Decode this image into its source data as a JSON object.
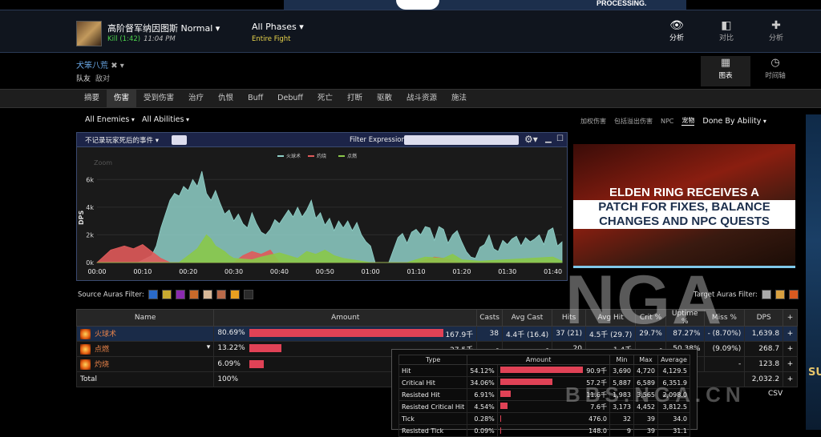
{
  "banner": {
    "text": "PROCESSING."
  },
  "header": {
    "boss": "高阶督军纳因图斯 Normal ▾",
    "kill": "Kill (1:42)",
    "time": "11:04 PM",
    "phases": "All Phases ▾",
    "fight": "Entire Fight",
    "nav": [
      {
        "label": "分析",
        "icon": "eye-icon",
        "glyph": "👁"
      },
      {
        "label": "对比",
        "icon": "compare-icon",
        "glyph": "◧"
      },
      {
        "label": "分析",
        "icon": "puzzle-icon",
        "glyph": "✚"
      }
    ]
  },
  "player": {
    "name": "犬笨八荒",
    "close": "✖ ▾",
    "team": "队友",
    "enemy": "敌对"
  },
  "views": [
    {
      "label": "图表",
      "icon": "grid-icon",
      "glyph": "▦"
    },
    {
      "label": "时间轴",
      "icon": "clock-icon",
      "glyph": "◷"
    }
  ],
  "tabs": [
    "摘要",
    "伤害",
    "受到伤害",
    "治疗",
    "仇恨",
    "Buff",
    "Debuff",
    "死亡",
    "打断",
    "驱散",
    "战斗资源",
    "施法"
  ],
  "filters": {
    "enemies": "All Enemies",
    "abilities": "All Abilities",
    "right": [
      "加权伤害",
      "包括溢出伤害",
      "NPC",
      "宠物"
    ],
    "done_by": "Done By Ability"
  },
  "graph": {
    "death_events": "不记录玩家死后的事件 ▾",
    "filter_expression": "Filter Expression:",
    "zoom": "Zoom"
  },
  "chart_data": {
    "type": "area",
    "ylabel": "DPS",
    "ylim": [
      0,
      7000
    ],
    "yticks": [
      "0k",
      "2k",
      "4k",
      "6k"
    ],
    "xticks": [
      "00:00",
      "00:10",
      "00:20",
      "00:30",
      "00:40",
      "00:50",
      "01:00",
      "01:10",
      "01:20",
      "01:30",
      "01:40"
    ],
    "xlim": [
      0,
      102
    ],
    "series": [
      {
        "name": "火球术",
        "color": "#8fd0c8",
        "x": [
          0,
          3,
          6,
          9,
          12,
          13,
          14,
          15,
          16,
          17,
          18,
          19,
          20,
          21,
          22,
          23,
          24,
          25,
          26,
          27,
          28,
          29,
          30,
          31,
          32,
          33,
          34,
          35,
          36,
          37,
          38,
          39,
          40,
          41,
          42,
          43,
          44,
          45,
          46,
          47,
          48,
          49,
          50,
          51,
          52,
          53,
          54,
          55,
          56,
          57,
          58,
          59,
          60,
          61,
          62,
          63,
          64,
          65,
          66,
          67,
          68,
          69,
          70,
          71,
          72,
          73,
          74,
          75,
          76,
          77,
          78,
          79,
          80,
          81,
          82,
          83,
          84,
          85,
          86,
          87,
          88,
          89,
          90,
          91,
          92,
          93,
          94,
          95,
          96,
          97,
          98,
          99,
          100,
          101,
          102
        ],
        "y": [
          0,
          0,
          0,
          0,
          500,
          1200,
          2500,
          3500,
          4500,
          5000,
          4800,
          5500,
          5200,
          6000,
          5500,
          6600,
          5000,
          4500,
          5200,
          4300,
          3500,
          3800,
          3000,
          3500,
          2800,
          2500,
          3600,
          2800,
          2200,
          2000,
          2400,
          3100,
          2800,
          3300,
          3800,
          3300,
          4000,
          3300,
          3800,
          4500,
          3200,
          3600,
          2700,
          3200,
          2300,
          3000,
          2500,
          3000,
          2300,
          2900,
          2000,
          1500,
          1200,
          0,
          0,
          0,
          0,
          900,
          1800,
          2100,
          1400,
          2200,
          2400,
          2000,
          2600,
          2500,
          1600,
          2600,
          2400,
          1400,
          2000,
          2300,
          1500,
          800,
          400,
          300,
          1100,
          1300,
          2000,
          1000,
          800,
          1600,
          1300,
          1700,
          1900,
          1200,
          1800,
          1500,
          1700,
          2000,
          1300,
          2300,
          2500,
          1200,
          1500
        ]
      },
      {
        "name": "灼烧",
        "color": "#e05a5a",
        "x": [
          0,
          3,
          6,
          8,
          10,
          12,
          14,
          16,
          30,
          32,
          34,
          36,
          38,
          40,
          70,
          74,
          76,
          80,
          84,
          100
        ],
        "y": [
          0,
          900,
          1200,
          1000,
          1300,
          800,
          300,
          0,
          0,
          500,
          800,
          600,
          900,
          0,
          0,
          400,
          300,
          0,
          0,
          0
        ]
      },
      {
        "name": "点燃",
        "color": "#8ac84a",
        "x": [
          0,
          18,
          20,
          22,
          23,
          24,
          25,
          26,
          27,
          28,
          29,
          30,
          34,
          36,
          40,
          44,
          46,
          48,
          50,
          52,
          54,
          56,
          60,
          68,
          70,
          72,
          76,
          78,
          80,
          84,
          100,
          102
        ],
        "y": [
          0,
          0,
          500,
          1000,
          1500,
          2000,
          1700,
          1200,
          1000,
          800,
          500,
          300,
          200,
          400,
          700,
          300,
          800,
          600,
          900,
          500,
          300,
          200,
          0,
          0,
          200,
          400,
          300,
          600,
          200,
          100,
          400,
          100
        ]
      }
    ]
  },
  "ad": {
    "line1": "ELDEN RING RECEIVES A",
    "line2": "PATCH FOR FIXES, BALANCE",
    "line3": "CHANGES AND NPC QUESTS"
  },
  "auras": {
    "source": "Source Auras Filter:",
    "target": "Target Auras Filter:",
    "source_colors": [
      "#2a6ac8",
      "#c8aa30",
      "#8a2ab0",
      "#c86a2a",
      "#d8b898",
      "#b86a4a",
      "#e8a020",
      "#2a2a2a"
    ],
    "target_colors": [
      "#aaaaaa",
      "#d8a040",
      "#d85a20"
    ]
  },
  "table": {
    "headers": [
      "Name",
      "Amount",
      "Casts",
      "Avg Cast",
      "Hits",
      "Avg Hit",
      "Crit %",
      "Uptime %",
      "Miss %",
      "DPS",
      "+"
    ],
    "rows": [
      {
        "name": "火球术",
        "pct": "80.69%",
        "bar": 0.8069,
        "amount": "167.9千",
        "casts": "38",
        "avgcast": "4.4千 (16.4)",
        "hits": "37 (21)",
        "avghit": "4.5千 (29.7)",
        "crit": "29.7%",
        "uptime": "87.27%",
        "miss": "- (8.70%)",
        "dps": "1,639.8",
        "plus": "+"
      },
      {
        "name": "点燃",
        "pct": "13.22%",
        "bar": 0.1322,
        "amount": "27.5千",
        "casts": "-",
        "avgcast": "-",
        "hits": "20",
        "avghit": "1.4千",
        "crit": "-",
        "uptime": "50.38%",
        "miss": "(9.09%)",
        "dps": "268.7",
        "plus": "+"
      },
      {
        "name": "灼烧",
        "pct": "6.09%",
        "bar": 0.0609,
        "amount": "",
        "casts": "",
        "avgcast": "",
        "hits": "",
        "avghit": "",
        "crit": "",
        "uptime": "",
        "miss": "-",
        "dps": "123.8",
        "plus": "+"
      }
    ],
    "total": {
      "label": "Total",
      "pct": "100%",
      "dps": "2,032.2",
      "plus": "+"
    }
  },
  "popup": {
    "headers": [
      "Type",
      "Amount",
      "Min",
      "Max",
      "Average"
    ],
    "rows": [
      {
        "type": "Hit",
        "pct": "54.12%",
        "bar": 0.5412,
        "amount": "90.9千",
        "min": "3,690",
        "max": "4,720",
        "avg": "4,129.5"
      },
      {
        "type": "Critical Hit",
        "pct": "34.06%",
        "bar": 0.3406,
        "amount": "57.2千",
        "min": "5,887",
        "max": "6,589",
        "avg": "6,351.9"
      },
      {
        "type": "Resisted Hit",
        "pct": "6.91%",
        "bar": 0.0691,
        "amount": "11.6千",
        "min": "1,983",
        "max": "3,565",
        "avg": "2,098.0"
      },
      {
        "type": "Resisted Critical Hit",
        "pct": "4.54%",
        "bar": 0.0454,
        "amount": "7.6千",
        "min": "3,173",
        "max": "4,452",
        "avg": "3,812.5"
      },
      {
        "type": "Tick",
        "pct": "0.28%",
        "bar": 0.0028,
        "amount": "476.0",
        "min": "32",
        "max": "39",
        "avg": "34.0"
      },
      {
        "type": "Resisted Tick",
        "pct": "0.09%",
        "bar": 0.0009,
        "amount": "148.0",
        "min": "9",
        "max": "39",
        "avg": "31.1"
      }
    ]
  },
  "watermark": {
    "main": "NGA",
    "sub": "BBS.NGA.CN"
  },
  "csv": "CSV",
  "ad2": {
    "text": "SU"
  }
}
